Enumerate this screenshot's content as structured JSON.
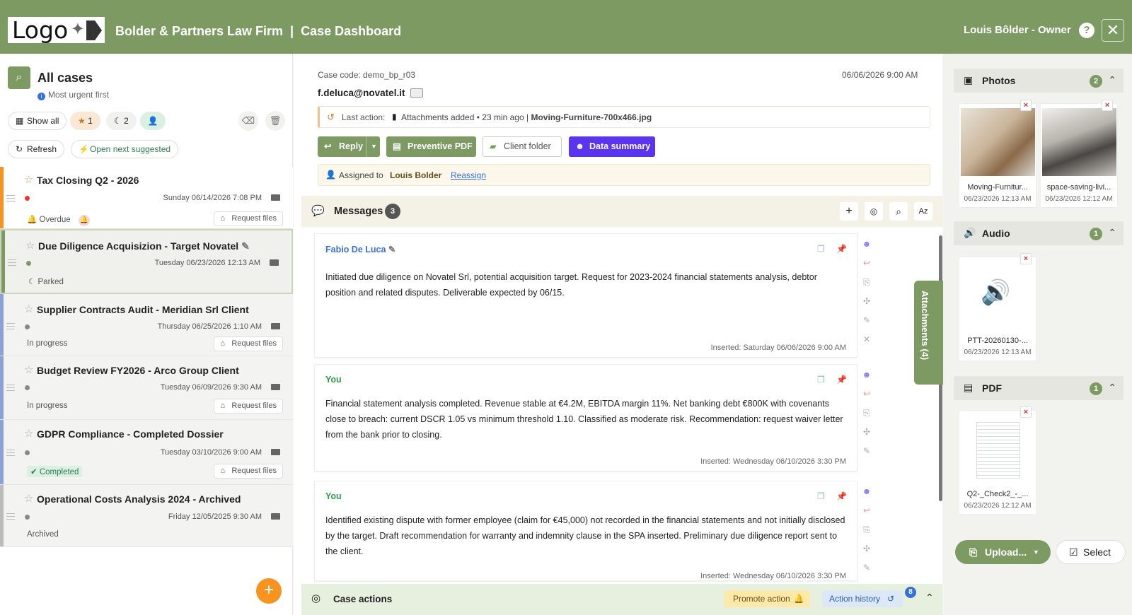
{
  "header": {
    "logo_text": "Logo",
    "title": "Bolder & Partners Law Firm  |  Case Dashboard",
    "user": "Louis Bôlder - Owner",
    "help": "?",
    "close": "✕"
  },
  "left": {
    "title": "All cases",
    "subtitle": "Most urgent first",
    "show_all": "Show all",
    "starred_count": "1",
    "parked_count": "2",
    "refresh": "Refresh",
    "open_next": "Open next suggested",
    "add": "+",
    "cases": [
      {
        "title": "Tax Closing Q2 - 2026",
        "date": "Sunday 06/14/2026 7:08 PM",
        "status": "Overdue",
        "request": "Request files",
        "bar": "#f7931e",
        "dot": "#e53935"
      },
      {
        "title": "Due Diligence Acquisizion - Target Novatel",
        "date": "Tuesday 06/23/2026 12:13 AM",
        "status": "Parked",
        "request": "",
        "bar": "#7d9a62",
        "dot": "#7d9a62"
      },
      {
        "title": "Supplier Contracts Audit - Meridian Srl Client",
        "date": "Thursday 06/25/2026 1:10 AM",
        "status": "In progress",
        "request": "Request files",
        "bar": "#8aa0d6",
        "dot": "#888"
      },
      {
        "title": "Budget Review FY2026 - Arco Group Client",
        "date": "Tuesday 06/09/2026 9:30 AM",
        "status": "In progress",
        "request": "Request files",
        "bar": "#8aa0d6",
        "dot": "#888"
      },
      {
        "title": "GDPR Compliance - Completed Dossier",
        "date": "Tuesday 03/10/2026 9:00 AM",
        "status": "Completed",
        "request": "Request files",
        "bar": "#8aa0d6",
        "dot": "#888"
      },
      {
        "title": "Operational Costs Analysis 2024 - Archived",
        "date": "Friday 12/05/2025 9:30 AM",
        "status": "Archived",
        "request": "",
        "bar": "#bbb",
        "dot": "#888"
      }
    ]
  },
  "case": {
    "code": "Case code: demo_bp_r03",
    "email": "f.deluca@novatel.it",
    "date": "06/06/2026 9:00 AM",
    "last_action_label": "Last action:",
    "last_action": "Attachments added",
    "last_action_time": "23 min ago",
    "last_action_file": "Moving-Furniture-700x466.jpg",
    "reply": "Reply",
    "preventive_pdf": "Preventive PDF",
    "client_folder": "Client folder",
    "data_summary": "Data summary",
    "assigned_label": "Assigned to",
    "assigned_to": "Louis Bolder",
    "reassign": "Reassign"
  },
  "messages": {
    "title": "Messages",
    "count": "3",
    "sort_label": "Az",
    "items": [
      {
        "author": "Fabio De Luca",
        "body": "Initiated due diligence on Novatel Srl, potential acquisition target. Request for 2023-2024 financial statements analysis, debtor position and related disputes. Deliverable expected by 06/15.",
        "inserted": "Inserted: Saturday 06/06/2026 9:00 AM"
      },
      {
        "author": "You",
        "body": "Financial statement analysis completed. Revenue stable at €4.2M, EBITDA margin 11%. Net banking debt €800K with covenants close to breach: current DSCR 1.05 vs minimum threshold 1.10. Classified as moderate risk. Recommendation: request waiver letter from the bank prior to closing.",
        "inserted": "Inserted: Wednesday 06/10/2026 3:30 PM"
      },
      {
        "author": "You",
        "body": "Identified existing dispute with former employee (claim for  €45,000) not recorded in the financial statements and not initially disclosed by the target. Draft recommendation for warranty and indemnity clause in the SPA inserted. Preliminary due diligence report sent to the client.",
        "inserted": "Inserted: Wednesday 06/10/2026 3:30 PM"
      }
    ]
  },
  "case_actions": {
    "title": "Case actions",
    "promote": "Promote action",
    "history": "Action history",
    "history_count": "8"
  },
  "attachments_tab": "Attachments (4)",
  "right": {
    "photos": {
      "label": "Photos",
      "count": "2",
      "items": [
        {
          "name": "Moving-Furnitur...",
          "date": "06/23/2026 12:13 AM"
        },
        {
          "name": "space-saving-livi...",
          "date": "06/23/2026 12:12 AM"
        }
      ]
    },
    "audio": {
      "label": "Audio",
      "count": "1",
      "items": [
        {
          "name": "PTT-20260130-...",
          "date": "06/23/2026 12:13 AM"
        }
      ]
    },
    "pdf": {
      "label": "PDF",
      "count": "1",
      "items": [
        {
          "name": "Q2-_Check2_-_...",
          "date": "06/23/2026 12:12 AM"
        }
      ]
    },
    "upload": "Upload...",
    "select": "Select"
  },
  "colors": {
    "brand": "#7d9a62",
    "accent_purple": "#5b34f0",
    "orange": "#f7931e"
  }
}
